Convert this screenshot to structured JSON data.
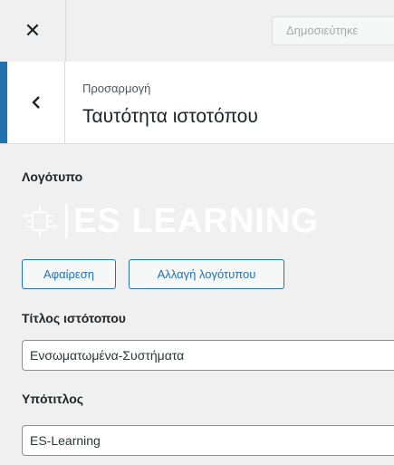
{
  "topbar": {
    "close_icon": "close-icon",
    "publish_label": "Δημοσιεύτηκε"
  },
  "section": {
    "back_icon": "chevron-left-icon",
    "breadcrumb": "Προσαρμογή",
    "title": "Ταυτότητα ιστοτόπου"
  },
  "logo": {
    "label": "Λογότυπο",
    "image_text": "ES LEARNING",
    "remove_label": "Αφαίρεση",
    "change_label": "Αλλαγή λογότυπου"
  },
  "site_title": {
    "label": "Τίτλος ιστότοπου",
    "value": "Ενσωματωμένα-Συστήματα"
  },
  "tagline": {
    "label": "Υπότιτλος",
    "value": "ES-Learning"
  },
  "colors": {
    "accent": "#2271b1",
    "panel_bg": "#f0f0f1",
    "header_bg": "#ffffff"
  }
}
